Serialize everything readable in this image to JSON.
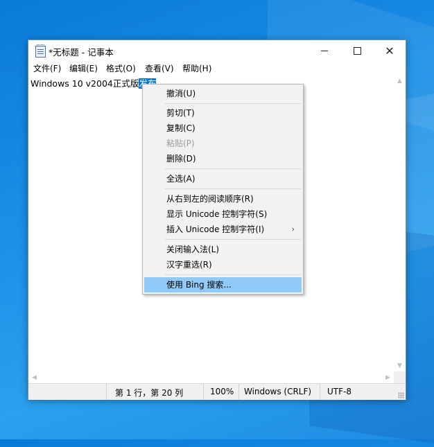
{
  "window": {
    "title": "*无标题 - 记事本"
  },
  "menubar": {
    "items": [
      "文件(F)",
      "编辑(E)",
      "格式(O)",
      "查看(V)",
      "帮助(H)"
    ]
  },
  "editor": {
    "text_before": "Windows 10 v2004正式版",
    "text_selected": "发布"
  },
  "context_menu": {
    "items": [
      {
        "label": "撤消(U)"
      },
      {
        "label": "剪切(T)"
      },
      {
        "label": "复制(C)"
      },
      {
        "label": "粘贴(P)"
      },
      {
        "label": "删除(D)"
      },
      {
        "label": "全选(A)"
      },
      {
        "label": "从右到左的阅读顺序(R)"
      },
      {
        "label": "显示 Unicode 控制字符(S)"
      },
      {
        "label": "插入 Unicode 控制字符(I)",
        "submenu_glyph": "›"
      },
      {
        "label": "关闭输入法(L)"
      },
      {
        "label": "汉字重选(R)"
      },
      {
        "label": "使用 Bing 搜索..."
      }
    ]
  },
  "statusbar": {
    "position": "第 1 行，第 20 列",
    "zoom": "100%",
    "line_ending": "Windows (CRLF)",
    "encoding": "UTF-8"
  },
  "colors": {
    "selection": "#0078d7",
    "menu_highlight": "#91c9f7",
    "desktop": "#1c8fe6"
  }
}
